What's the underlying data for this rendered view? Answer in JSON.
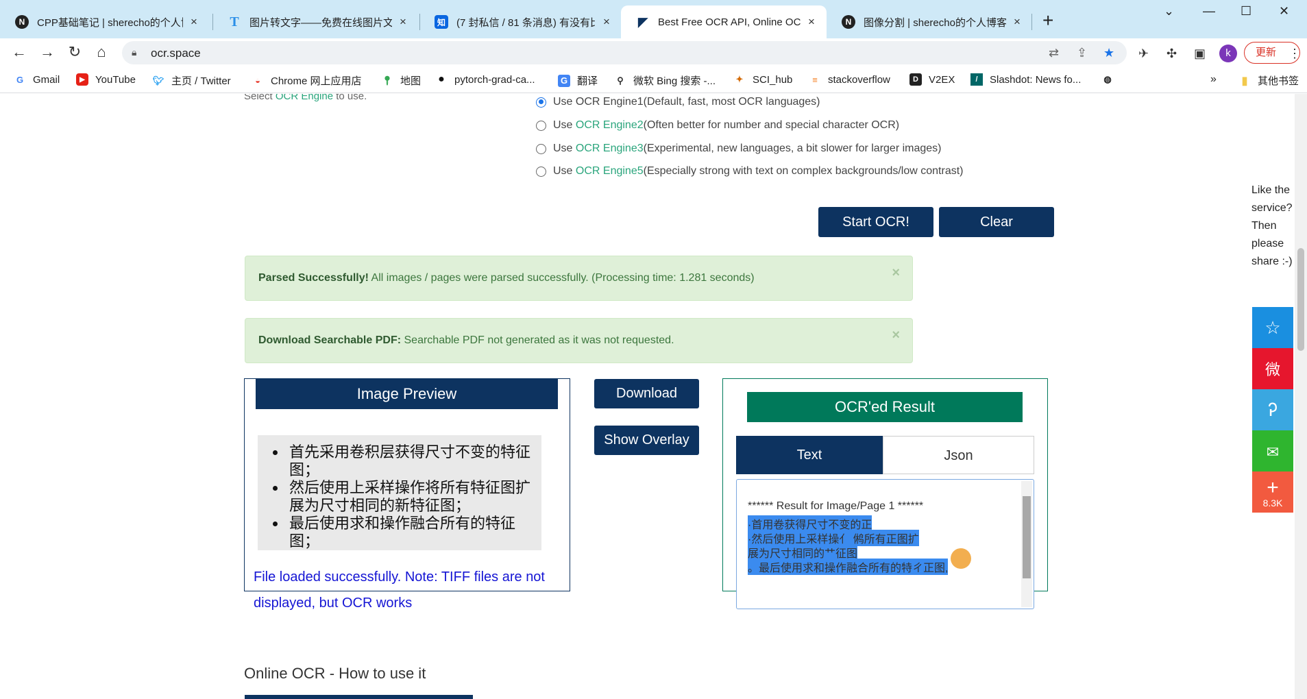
{
  "browser": {
    "tabs": [
      {
        "title": "CPP基础笔记 | sherecho的个人博",
        "favicon": "N",
        "active": false
      },
      {
        "title": "图片转文字——免费在线图片文字",
        "favicon": "T",
        "active": false
      },
      {
        "title": "(7 封私信 / 81 条消息) 有没有比",
        "favicon": "知",
        "active": false
      },
      {
        "title": "Best Free OCR API, Online OCR",
        "favicon": "ocr-logo",
        "active": true
      },
      {
        "title": "图像分割 | sherecho的个人博客",
        "favicon": "N",
        "active": false
      }
    ],
    "url": "ocr.space",
    "profile_initial": "k",
    "update_label": "更新",
    "bookmarks": [
      {
        "label": "Gmail",
        "icon": "G"
      },
      {
        "label": "YouTube",
        "icon": "youtube-icon"
      },
      {
        "label": "主页 / Twitter",
        "icon": "twitter-icon"
      },
      {
        "label": "Chrome 网上应用店",
        "icon": "chrome-icon"
      },
      {
        "label": "地图",
        "icon": "maps-icon"
      },
      {
        "label": "pytorch-grad-ca...",
        "icon": "github-icon"
      },
      {
        "label": "翻译",
        "icon": "translate-icon"
      },
      {
        "label": "微软 Bing 搜索 -...",
        "icon": "search-icon"
      },
      {
        "label": "SCI_hub",
        "icon": "scihub-icon"
      },
      {
        "label": "stackoverflow",
        "icon": "stackoverflow-icon"
      },
      {
        "label": "V2EX",
        "icon": "v2ex-icon"
      },
      {
        "label": "Slashdot: News fo...",
        "icon": "slashdot-icon"
      }
    ],
    "other_bookmarks": "其他书签"
  },
  "ocr": {
    "engine_prefix": "Select ",
    "engine_link": "OCR Engine",
    "engine_suffix": " to use.",
    "engines": [
      {
        "prefix": "Use ",
        "name": "OCR Engine1",
        "desc": " (Default, fast, most OCR languages)",
        "selected": true,
        "is_link": false
      },
      {
        "prefix": "Use ",
        "name": "OCR Engine2",
        "desc": " (Often better for number and special character OCR)",
        "selected": false,
        "is_link": true
      },
      {
        "prefix": "Use ",
        "name": "OCR Engine3",
        "desc": " (Experimental, new languages, a bit slower for larger images)",
        "selected": false,
        "is_link": true
      },
      {
        "prefix": "Use ",
        "name": "OCR Engine5",
        "desc": " (Especially strong with text on complex backgrounds/low contrast)",
        "selected": false,
        "is_link": true
      }
    ],
    "start_label": "Start OCR!",
    "clear_label": "Clear",
    "alert_parsed_title": "Parsed Successfully!",
    "alert_parsed_text": " All images / pages were parsed successfully. (Processing time: 1.281 seconds)",
    "alert_pdf_title": "Download Searchable PDF:",
    "alert_pdf_text": " Searchable PDF not generated as it was not requested.",
    "close_symbol": "×",
    "preview_title": "Image Preview",
    "preview_lines": [
      "首先采用卷积层获得尺寸不变的特征图；",
      "然后使用上采样操作将所有特征图扩展为尺寸相同的新特征图；",
      "最后使用求和操作融合所有的特征图；"
    ],
    "file_note": "File loaded successfully. Note: TIFF files are not displayed, but OCR works",
    "download_label": "Download",
    "overlay_label": "Show Overlay",
    "result_title": "OCR'ed Result",
    "tab_text": "Text",
    "tab_json": "Json",
    "result_lines": [
      "****** Result for Image/Page 1 ******",
      "·首用卷获得尺寸不变的正",
      "·然后使用上采样操亻 鸺所有正图扩",
      "展为尺寸相同的艹征图",
      "。最后使用求和操作融合所有的特ㄔ正图,"
    ],
    "section_title": "Online OCR - How to use it"
  },
  "share": {
    "prompt": "Like the service? Then please share :-)",
    "buttons": [
      {
        "name": "qzone",
        "glyph": "☆",
        "color": "#1a8fe0"
      },
      {
        "name": "weibo",
        "glyph": "微",
        "color": "#e6162d"
      },
      {
        "name": "tencent-weibo",
        "glyph": "Ꭾ",
        "color": "#3aa7e0"
      },
      {
        "name": "wechat",
        "glyph": "✉",
        "color": "#2fb52f"
      },
      {
        "name": "more",
        "glyph": "+",
        "color": "#f25a3f"
      }
    ],
    "count": "8.3K"
  },
  "colors": {
    "navy": "#0d3360",
    "green": "#00795a",
    "link": "#2aa57c",
    "alert_bg": "#dff0d8"
  }
}
